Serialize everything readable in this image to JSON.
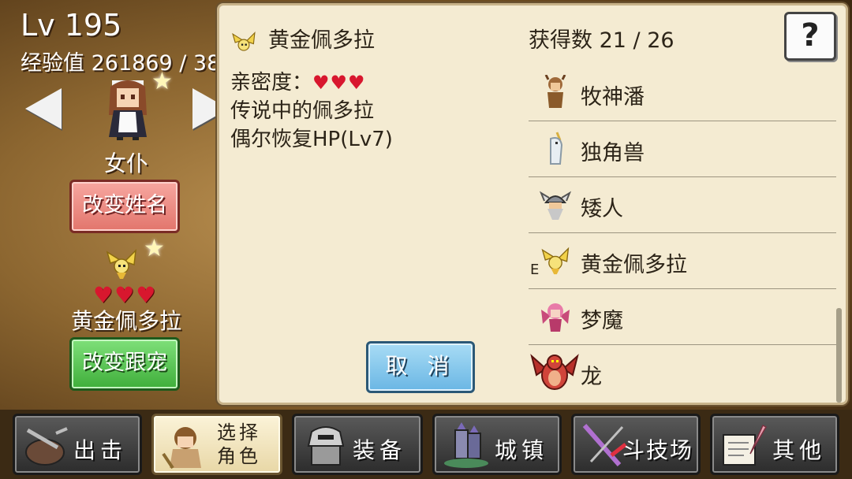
{
  "left": {
    "level": "Lv 195",
    "exp": "经验值 261869 / 38",
    "character_name": "女仆",
    "rename_label": "改变姓名",
    "pet_hearts": "♥♥♥",
    "pet_name": "黄金佩多拉",
    "change_pet_label": "改变跟宠"
  },
  "dialog": {
    "pet_title": "黄金佩多拉",
    "count": "获得数 21 / 26",
    "help_label": "?",
    "affinity_label": "亲密度：",
    "affinity_hearts": "♥♥♥",
    "description_1": "传说中的佩多拉",
    "description_2": "偶尔恢复HP(Lv7)",
    "cancel_label": "取 消",
    "pets": [
      {
        "name": "牧神潘",
        "icon": "satyr-icon",
        "mark": ""
      },
      {
        "name": "独角兽",
        "icon": "unicorn-icon",
        "mark": ""
      },
      {
        "name": "矮人",
        "icon": "dwarf-icon",
        "mark": ""
      },
      {
        "name": "黄金佩多拉",
        "icon": "golden-fairy-icon",
        "mark": "E"
      },
      {
        "name": "梦魔",
        "icon": "succubus-icon",
        "mark": ""
      },
      {
        "name": "龙",
        "icon": "dragon-icon",
        "mark": ""
      }
    ]
  },
  "nav": {
    "attack": "出击",
    "select_character": "选择角色",
    "equipment": "装备",
    "town": "城镇",
    "arena": "斗技场",
    "other": "其他"
  },
  "colors": {
    "hearts": "#d8172e",
    "rename_button": "#e2756c",
    "change_pet_button": "#3fae3a",
    "cancel_button": "#6ab6e4",
    "dialog_bg": "#f4ebd2"
  }
}
